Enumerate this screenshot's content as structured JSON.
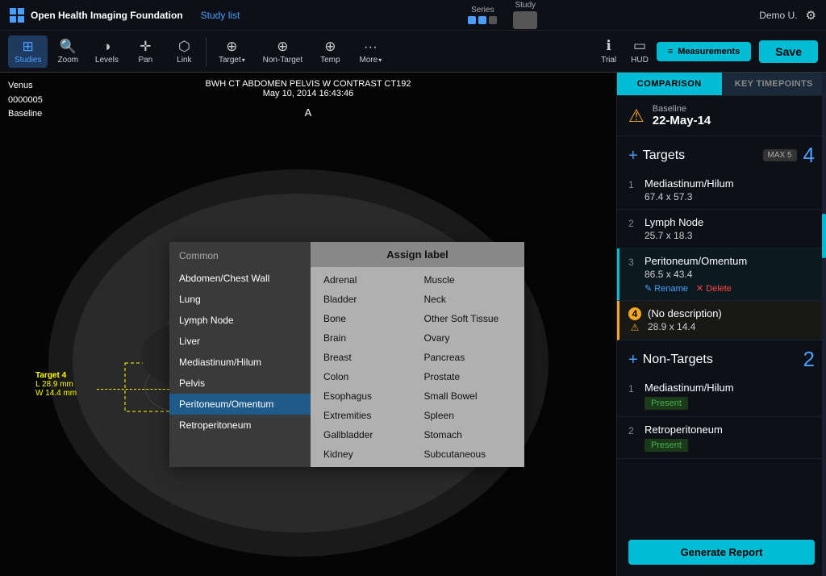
{
  "app": {
    "title": "Open Health Imaging Foundation",
    "study_list": "Study list"
  },
  "header": {
    "series_label": "Series",
    "study_label": "Study",
    "user": "Demo U.",
    "save_label": "Save"
  },
  "toolbar": {
    "tools": [
      {
        "id": "studies",
        "label": "Studies",
        "icon": "⊞",
        "active": true
      },
      {
        "id": "zoom",
        "label": "Zoom",
        "icon": "🔍",
        "active": false
      },
      {
        "id": "levels",
        "label": "Levels",
        "icon": "◑",
        "active": false
      },
      {
        "id": "pan",
        "label": "Pan",
        "icon": "✛",
        "active": false
      },
      {
        "id": "link",
        "label": "Link",
        "icon": "⬡",
        "active": false
      },
      {
        "id": "target",
        "label": "Target",
        "icon": "⊕",
        "active": false,
        "has_dropdown": true
      },
      {
        "id": "non-target",
        "label": "Non-Target",
        "icon": "⊕",
        "active": false
      },
      {
        "id": "temp",
        "label": "Temp",
        "icon": "⊕",
        "active": false
      },
      {
        "id": "more",
        "label": "More",
        "icon": "···",
        "active": false,
        "has_dropdown": true
      }
    ],
    "trial_label": "Trial",
    "hud_label": "HUD",
    "measurements_label": "Measurements"
  },
  "image": {
    "patient": "Venus",
    "id": "0000005",
    "timepoint": "Baseline",
    "title": "BWH CT ABDOMEN PELVIS W CONTRAST CT192",
    "date": "May 10, 2014 16:43:46",
    "orientation_label": "A",
    "target_label": "Target 4",
    "target_l": "L 28.9 mm",
    "target_w": "W 14.4 mm"
  },
  "dropdown": {
    "assign_label": "Assign label",
    "common_header": "Common",
    "common_items": [
      "Abdomen/Chest Wall",
      "Lung",
      "Lymph Node",
      "Liver",
      "Mediastinum/Hilum",
      "Pelvis",
      "Peritoneum/Omentum",
      "Retroperitoneum"
    ],
    "assign_col1": [
      "Adrenal",
      "Bladder",
      "Bone",
      "Brain",
      "Breast",
      "Colon",
      "Esophagus",
      "Extremities",
      "Gallbladder",
      "Kidney"
    ],
    "assign_col2": [
      "Muscle",
      "Neck",
      "Other Soft Tissue",
      "Ovary",
      "Pancreas",
      "Prostate",
      "Small Bowel",
      "Spleen",
      "Stomach",
      "Subcutaneous"
    ]
  },
  "right_panel": {
    "tab_comparison": "COMPARISON",
    "tab_key_timepoints": "KEY TIMEPOINTS",
    "baseline_label": "Baseline",
    "baseline_date": "22-May-14",
    "targets_label": "Targets",
    "targets_max": "MAX 5",
    "targets_count": "4",
    "targets": [
      {
        "num": "1",
        "name": "Mediastinum/Hilum",
        "size": "67.4 x 57.3",
        "selected": false,
        "warning": false
      },
      {
        "num": "2",
        "name": "Lymph Node",
        "size": "25.7 x 18.3",
        "selected": false,
        "warning": false
      },
      {
        "num": "3",
        "name": "Peritoneum/Omentum",
        "size": "86.5 x 43.4",
        "selected": true,
        "warning": false
      },
      {
        "num": "4",
        "name": "(No description)",
        "size": "28.9 x 14.4",
        "selected": false,
        "warning": true
      }
    ],
    "rename_label": "✎ Rename",
    "delete_label": "✕ Delete",
    "non_targets_label": "Non-Targets",
    "non_targets_count": "2",
    "non_targets": [
      {
        "num": "1",
        "name": "Mediastinum/Hilum",
        "status": "Present"
      },
      {
        "num": "2",
        "name": "Retroperitoneum",
        "status": "Present"
      }
    ],
    "generate_report": "Generate Report"
  }
}
